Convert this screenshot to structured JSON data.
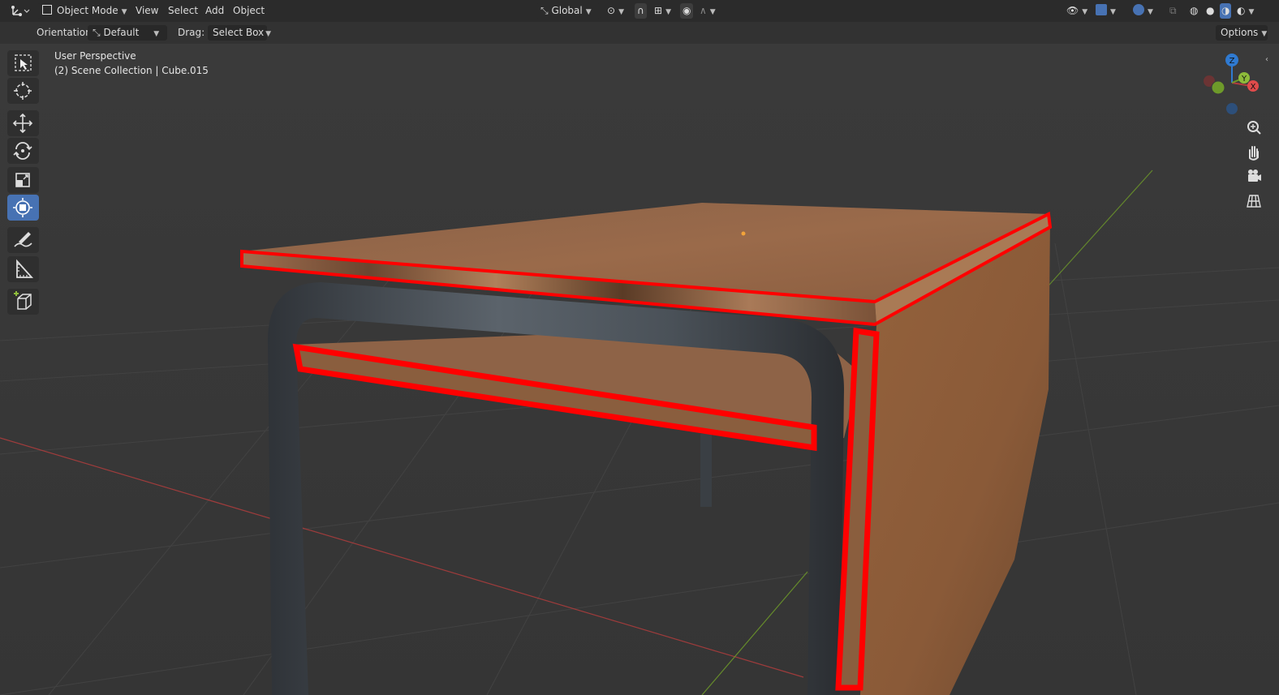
{
  "header": {
    "editor_type_icon": "axis-editor-icon",
    "mode": "Object Mode",
    "menus": [
      "View",
      "Select",
      "Add",
      "Object"
    ],
    "transform_orientation": "Global"
  },
  "tool_settings": {
    "orientation_label": "Orientation:",
    "orientation_value": "Default",
    "drag_label": "Drag:",
    "drag_value": "Select Box",
    "options_label": "Options"
  },
  "viewport": {
    "perspective": "User Perspective",
    "collection_info": "(2) Scene Collection | Cube.015",
    "gizmo": {
      "z": "Z",
      "y": "Y",
      "x": "X"
    }
  },
  "toolbar": {
    "tools": [
      "select-box-icon",
      "cursor-icon",
      "move-icon",
      "rotate-icon",
      "scale-icon",
      "transform-icon",
      "annotate-icon",
      "measure-icon",
      "add-cube-icon"
    ],
    "active_tool": "transform-icon"
  },
  "colors": {
    "selection_outline": "#ff0000",
    "active_tool": "#4772b3",
    "x_axis": "#b13d3d",
    "y_axis": "#6e9a2a",
    "z_axis": "#2f7ad1"
  }
}
